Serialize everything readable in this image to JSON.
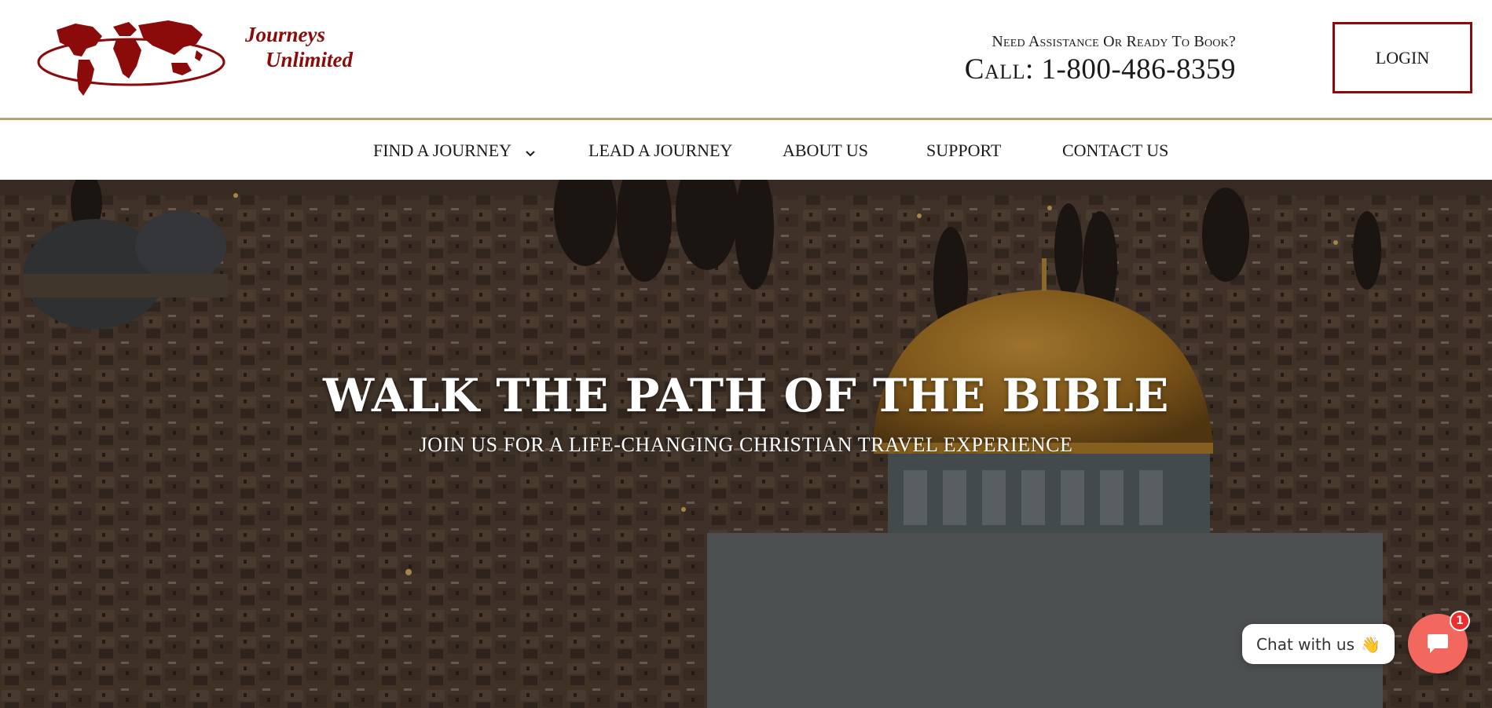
{
  "brand": {
    "name_line1": "Journeys",
    "name_line2": "Unlimited",
    "color": "#8b0a0a"
  },
  "header": {
    "assist_text": "Need Assistance Or Ready To Book?",
    "call_text": "Call: 1-800-486-8359",
    "login_label": "LOGIN",
    "rule_color": "#b5a372"
  },
  "nav": {
    "items": [
      {
        "label": "FIND A JOURNEY",
        "icon": "chevron-down-icon"
      },
      {
        "label": "LEAD A JOURNEY"
      },
      {
        "label": "ABOUT US"
      },
      {
        "label": "SUPPORT"
      },
      {
        "label": "CONTACT US"
      }
    ]
  },
  "hero": {
    "title": "WALK THE PATH OF THE BIBLE",
    "subtitle": "JOIN US FOR A LIFE-CHANGING CHRISTIAN TRAVEL EXPERIENCE",
    "background": "jerusalem-cityscape-dome-of-the-rock"
  },
  "chat": {
    "label": "Chat with us",
    "emoji": "👋",
    "badge_count": "1",
    "icon": "chat-bubble-icon",
    "accent": "#f2685e"
  }
}
